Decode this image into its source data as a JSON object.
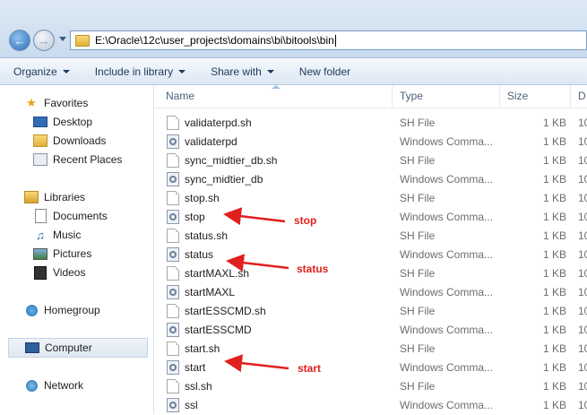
{
  "address": {
    "path": "E:\\Oracle\\12c\\user_projects\\domains\\bi\\bitools\\bin"
  },
  "toolbar": {
    "organize": "Organize",
    "include": "Include in library",
    "share": "Share with",
    "newfolder": "New folder"
  },
  "nav": {
    "favorites": "Favorites",
    "desktop": "Desktop",
    "downloads": "Downloads",
    "recent": "Recent Places",
    "libraries": "Libraries",
    "documents": "Documents",
    "music": "Music",
    "pictures": "Pictures",
    "videos": "Videos",
    "homegroup": "Homegroup",
    "computer": "Computer",
    "network": "Network"
  },
  "columns": {
    "name": "Name",
    "type": "Type",
    "size": "Size",
    "date": "D"
  },
  "files": [
    {
      "name": "validaterpd.sh",
      "type": "SH File",
      "size": "1 KB",
      "date": "10"
    },
    {
      "name": "validaterpd",
      "type": "Windows Comma...",
      "size": "1 KB",
      "date": "10"
    },
    {
      "name": "sync_midtier_db.sh",
      "type": "SH File",
      "size": "1 KB",
      "date": "10"
    },
    {
      "name": "sync_midtier_db",
      "type": "Windows Comma...",
      "size": "1 KB",
      "date": "10"
    },
    {
      "name": "stop.sh",
      "type": "SH File",
      "size": "1 KB",
      "date": "10"
    },
    {
      "name": "stop",
      "type": "Windows Comma...",
      "size": "1 KB",
      "date": "10"
    },
    {
      "name": "status.sh",
      "type": "SH File",
      "size": "1 KB",
      "date": "10"
    },
    {
      "name": "status",
      "type": "Windows Comma...",
      "size": "1 KB",
      "date": "10"
    },
    {
      "name": "startMAXL.sh",
      "type": "SH File",
      "size": "1 KB",
      "date": "10"
    },
    {
      "name": "startMAXL",
      "type": "Windows Comma...",
      "size": "1 KB",
      "date": "10"
    },
    {
      "name": "startESSCMD.sh",
      "type": "SH File",
      "size": "1 KB",
      "date": "10"
    },
    {
      "name": "startESSCMD",
      "type": "Windows Comma...",
      "size": "1 KB",
      "date": "10"
    },
    {
      "name": "start.sh",
      "type": "SH File",
      "size": "1 KB",
      "date": "10"
    },
    {
      "name": "start",
      "type": "Windows Comma...",
      "size": "1 KB",
      "date": "10"
    },
    {
      "name": "ssl.sh",
      "type": "SH File",
      "size": "1 KB",
      "date": "10"
    },
    {
      "name": "ssl",
      "type": "Windows Comma...",
      "size": "1 KB",
      "date": "10"
    }
  ],
  "annotations": {
    "stop": "stop",
    "status": "status",
    "start": "start"
  },
  "colors": {
    "accent": "#e0201e",
    "selection": "#dfe8f1"
  }
}
